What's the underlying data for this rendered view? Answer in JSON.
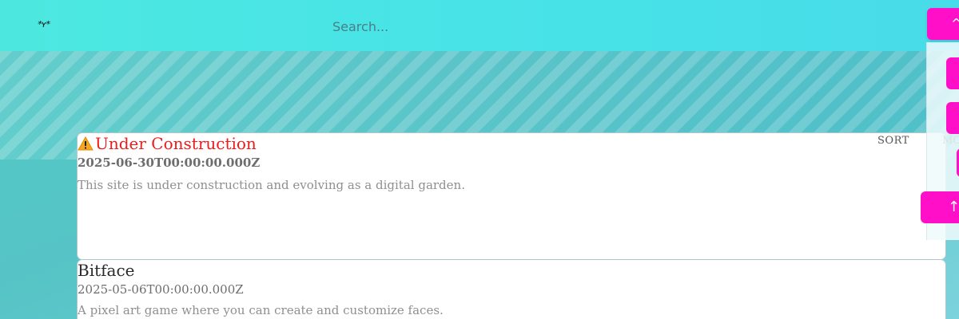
{
  "header": {
    "logo_text": "*ʏ*",
    "search_placeholder": "Search..."
  },
  "controls": {
    "top_button_glyph": "^",
    "scroll_up_glyph": "↑",
    "sort_label": "SORT",
    "sort_label_2": "MO"
  },
  "posts": [
    {
      "title": "Under Construction",
      "date": "2025-06-30T00:00:00.000Z",
      "description": "This site is under construction and evolving as a digital garden.",
      "warning": true
    },
    {
      "title": "Bitface",
      "date": "2025-05-06T00:00:00.000Z",
      "description": "A pixel art game where you can create and customize faces.",
      "warning": false
    }
  ],
  "colors": {
    "accent_pink": "#ff10c8",
    "header_cyan": "#47e2e8",
    "warning_red": "#ee1b1b"
  }
}
